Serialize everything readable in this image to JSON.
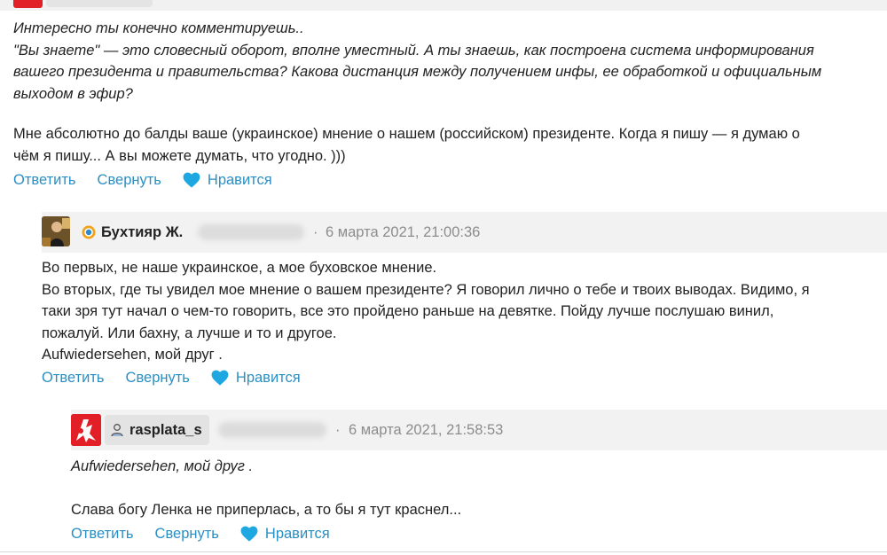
{
  "colors": {
    "link": "#2a8fc4",
    "heart": "#1ea7e0",
    "text": "#222222",
    "muted": "#8c8c8c",
    "header_bg": "#f2f2f2",
    "avatar_red": "#e21e27"
  },
  "first_comment": {
    "lines": [
      "Интересно ты конечно комментируешь..",
      "\"Вы знаете\" — это словесный оборот, вполне уместный. А ты знаешь, как построена система информирования",
      "вашего президента и правительства? Какова дистанция между получением инфы, ее обработкой и официальным",
      "выходом в эфир?"
    ],
    "lines2": [
      "Мне абсолютно до балды ваше (украинское) мнение о нашем (российском) президенте. Когда я пишу — я думаю о",
      "чём я пишу... А вы можете думать, что угодно. )))"
    ],
    "actions": {
      "reply": "Ответить",
      "collapse": "Свернуть",
      "like": "Нравится"
    }
  },
  "second_comment": {
    "username": "Бухтияр Ж.",
    "avatar_icon": "user-avatar-photo",
    "status_icon": "online-badge-icon",
    "separator": "·",
    "timestamp": "6 марта 2021, 21:00:36",
    "lines": [
      "Во первых, не наше украинское, а мое буховское мнение.",
      "Во вторых, где ты увидел мое мнение о вашем президенте? Я говорил лично о тебе и твоих выводах. Видимо, я",
      "таки зря тут начал о чем-то говорить, все это пройдено раньше на девятке. Пойду лучше послушаю винил,",
      "пожалуй. Или бахну, а лучше и то и другое.",
      "Aufwiedersehen, мой друг ."
    ],
    "actions": {
      "reply": "Ответить",
      "collapse": "Свернуть",
      "like": "Нравится"
    }
  },
  "third_comment": {
    "username": "rasplata_s",
    "avatar_icon": "red-logo-avatar",
    "status_icon": "user-silhouette-icon",
    "separator": "·",
    "timestamp": "6 марта 2021, 21:58:53",
    "quote": "Aufwiedersehen, мой друг .",
    "line": "Слава богу Ленка не приперлась, а то бы я тут краснел...",
    "actions": {
      "reply": "Ответить",
      "collapse": "Свернуть",
      "like": "Нравится"
    }
  }
}
